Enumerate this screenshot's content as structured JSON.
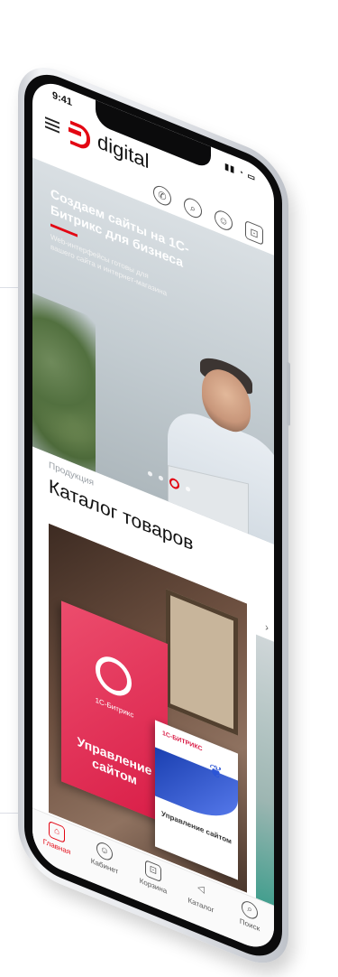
{
  "status": {
    "time": "9:41",
    "signal": "▮▮ ◔ ▭"
  },
  "header": {
    "brand": "digital",
    "icons": [
      "phone-icon",
      "search-icon",
      "user-icon",
      "cart-icon"
    ]
  },
  "hero": {
    "title": "Создаем сайты на 1С-Битрикс для бизнеса",
    "subtitle": "Web-интерфейсы готовы для вашего сайта и интернет-магазина",
    "slide_count": 4,
    "active_slide": 2
  },
  "catalog": {
    "overline": "Продукция",
    "title": "Каталог товаров",
    "product1": {
      "brand": "1С-Битрикс",
      "name": "Управление сайтом"
    },
    "product2": {
      "brand": "1С-БИТРИКС",
      "name": "Управление сайтом"
    }
  },
  "tabbar": [
    {
      "label": "Главная",
      "icon": "home-icon",
      "active": true
    },
    {
      "label": "Кабинет",
      "icon": "user-icon",
      "active": false
    },
    {
      "label": "Корзина",
      "icon": "cart-icon",
      "active": false
    },
    {
      "label": "Каталог",
      "icon": "send-icon",
      "active": false
    },
    {
      "label": "Поиск",
      "icon": "search-icon",
      "active": false
    }
  ],
  "colors": {
    "accent": "#e30613",
    "frame": "#0b0b0c"
  }
}
